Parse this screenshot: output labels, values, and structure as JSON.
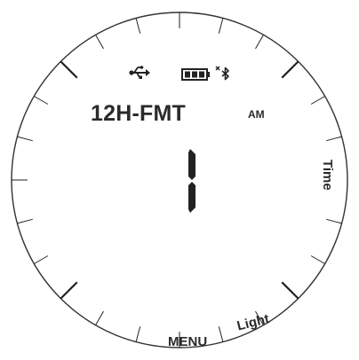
{
  "display": {
    "format_label": "12H-FMT",
    "ampm_label": "AM",
    "digit_value": "1"
  },
  "buttons": {
    "menu_label": "MENU",
    "light_label": "Light",
    "time_label": "Time"
  },
  "status_icons": [
    "usb-icon",
    "battery-icon",
    "bluetooth-icon"
  ],
  "colors": {
    "ink": "#222222",
    "background": "#ffffff"
  }
}
